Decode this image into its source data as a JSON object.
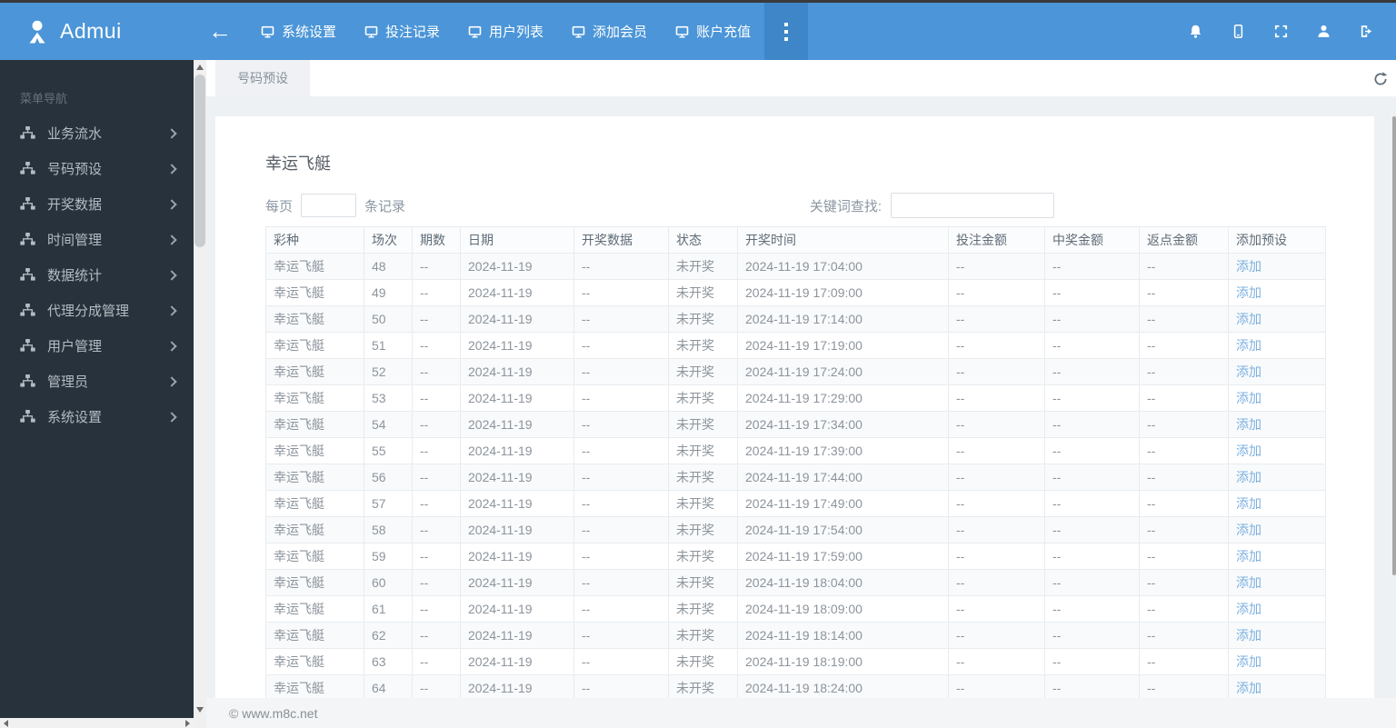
{
  "brand": {
    "name": "Admui"
  },
  "navbar": {
    "items": [
      {
        "label": "系统设置"
      },
      {
        "label": "投注记录"
      },
      {
        "label": "用户列表"
      },
      {
        "label": "添加会员"
      },
      {
        "label": "账户充值"
      }
    ],
    "right_icons": [
      "bell",
      "mobile",
      "fullscreen",
      "user",
      "logout"
    ]
  },
  "sidebar": {
    "heading": "菜单导航",
    "items": [
      {
        "label": "业务流水"
      },
      {
        "label": "号码预设"
      },
      {
        "label": "开奖数据"
      },
      {
        "label": "时间管理"
      },
      {
        "label": "数据统计"
      },
      {
        "label": "代理分成管理"
      },
      {
        "label": "用户管理"
      },
      {
        "label": "管理员"
      },
      {
        "label": "系统设置"
      }
    ]
  },
  "tabs": {
    "active_label": "号码预设"
  },
  "content": {
    "title": "幸运飞艇",
    "per_page": {
      "prefix": "每页",
      "suffix": "条记录",
      "value": ""
    },
    "keyword": {
      "label": "关键词查找:",
      "value": ""
    }
  },
  "table": {
    "headers": [
      "彩种",
      "场次",
      "期数",
      "日期",
      "开奖数据",
      "状态",
      "开奖时间",
      "投注金额",
      "中奖金额",
      "返点金额",
      "添加预设"
    ],
    "add_label": "添加",
    "rows": [
      [
        "幸运飞艇",
        "48",
        "--",
        "2024-11-19",
        "--",
        "未开奖",
        "2024-11-19 17:04:00",
        "--",
        "--",
        "--"
      ],
      [
        "幸运飞艇",
        "49",
        "--",
        "2024-11-19",
        "--",
        "未开奖",
        "2024-11-19 17:09:00",
        "--",
        "--",
        "--"
      ],
      [
        "幸运飞艇",
        "50",
        "--",
        "2024-11-19",
        "--",
        "未开奖",
        "2024-11-19 17:14:00",
        "--",
        "--",
        "--"
      ],
      [
        "幸运飞艇",
        "51",
        "--",
        "2024-11-19",
        "--",
        "未开奖",
        "2024-11-19 17:19:00",
        "--",
        "--",
        "--"
      ],
      [
        "幸运飞艇",
        "52",
        "--",
        "2024-11-19",
        "--",
        "未开奖",
        "2024-11-19 17:24:00",
        "--",
        "--",
        "--"
      ],
      [
        "幸运飞艇",
        "53",
        "--",
        "2024-11-19",
        "--",
        "未开奖",
        "2024-11-19 17:29:00",
        "--",
        "--",
        "--"
      ],
      [
        "幸运飞艇",
        "54",
        "--",
        "2024-11-19",
        "--",
        "未开奖",
        "2024-11-19 17:34:00",
        "--",
        "--",
        "--"
      ],
      [
        "幸运飞艇",
        "55",
        "--",
        "2024-11-19",
        "--",
        "未开奖",
        "2024-11-19 17:39:00",
        "--",
        "--",
        "--"
      ],
      [
        "幸运飞艇",
        "56",
        "--",
        "2024-11-19",
        "--",
        "未开奖",
        "2024-11-19 17:44:00",
        "--",
        "--",
        "--"
      ],
      [
        "幸运飞艇",
        "57",
        "--",
        "2024-11-19",
        "--",
        "未开奖",
        "2024-11-19 17:49:00",
        "--",
        "--",
        "--"
      ],
      [
        "幸运飞艇",
        "58",
        "--",
        "2024-11-19",
        "--",
        "未开奖",
        "2024-11-19 17:54:00",
        "--",
        "--",
        "--"
      ],
      [
        "幸运飞艇",
        "59",
        "--",
        "2024-11-19",
        "--",
        "未开奖",
        "2024-11-19 17:59:00",
        "--",
        "--",
        "--"
      ],
      [
        "幸运飞艇",
        "60",
        "--",
        "2024-11-19",
        "--",
        "未开奖",
        "2024-11-19 18:04:00",
        "--",
        "--",
        "--"
      ],
      [
        "幸运飞艇",
        "61",
        "--",
        "2024-11-19",
        "--",
        "未开奖",
        "2024-11-19 18:09:00",
        "--",
        "--",
        "--"
      ],
      [
        "幸运飞艇",
        "62",
        "--",
        "2024-11-19",
        "--",
        "未开奖",
        "2024-11-19 18:14:00",
        "--",
        "--",
        "--"
      ],
      [
        "幸运飞艇",
        "63",
        "--",
        "2024-11-19",
        "--",
        "未开奖",
        "2024-11-19 18:19:00",
        "--",
        "--",
        "--"
      ],
      [
        "幸运飞艇",
        "64",
        "--",
        "2024-11-19",
        "--",
        "未开奖",
        "2024-11-19 18:24:00",
        "--",
        "--",
        "--"
      ]
    ]
  },
  "footer": {
    "copyright": "© www.m8c.net"
  },
  "colors": {
    "navbar": "#4b95d8",
    "navbar_more": "#3e86c7",
    "sidebar": "#28323c",
    "link": "#7db0e0",
    "tab_active_bg": "#eff1f4"
  }
}
